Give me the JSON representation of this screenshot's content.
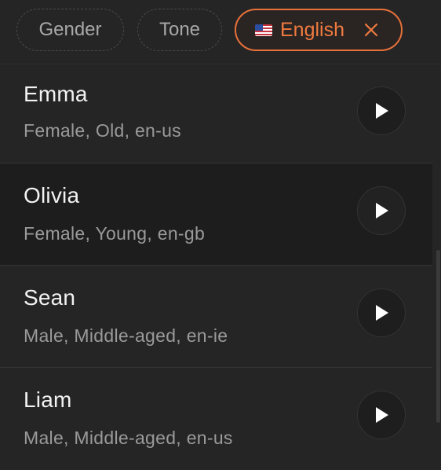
{
  "filters": {
    "gender_label": "Gender",
    "tone_label": "Tone",
    "language": {
      "flag": "us-flag",
      "label": "English",
      "clear_icon": "close-icon"
    }
  },
  "voices": [
    {
      "name": "Emma",
      "details": "Female, Old, en-us",
      "action_icon": "play-icon"
    },
    {
      "name": "Olivia",
      "details": "Female, Young, en-gb",
      "action_icon": "play-icon"
    },
    {
      "name": "Sean",
      "details": "Male, Middle-aged, en-ie",
      "action_icon": "play-icon"
    },
    {
      "name": "Liam",
      "details": "Male, Middle-aged, en-us",
      "action_icon": "play-icon"
    }
  ],
  "colors": {
    "accent": "#e8713a",
    "background": "#252525",
    "selected_row": "#1d1d1d"
  }
}
